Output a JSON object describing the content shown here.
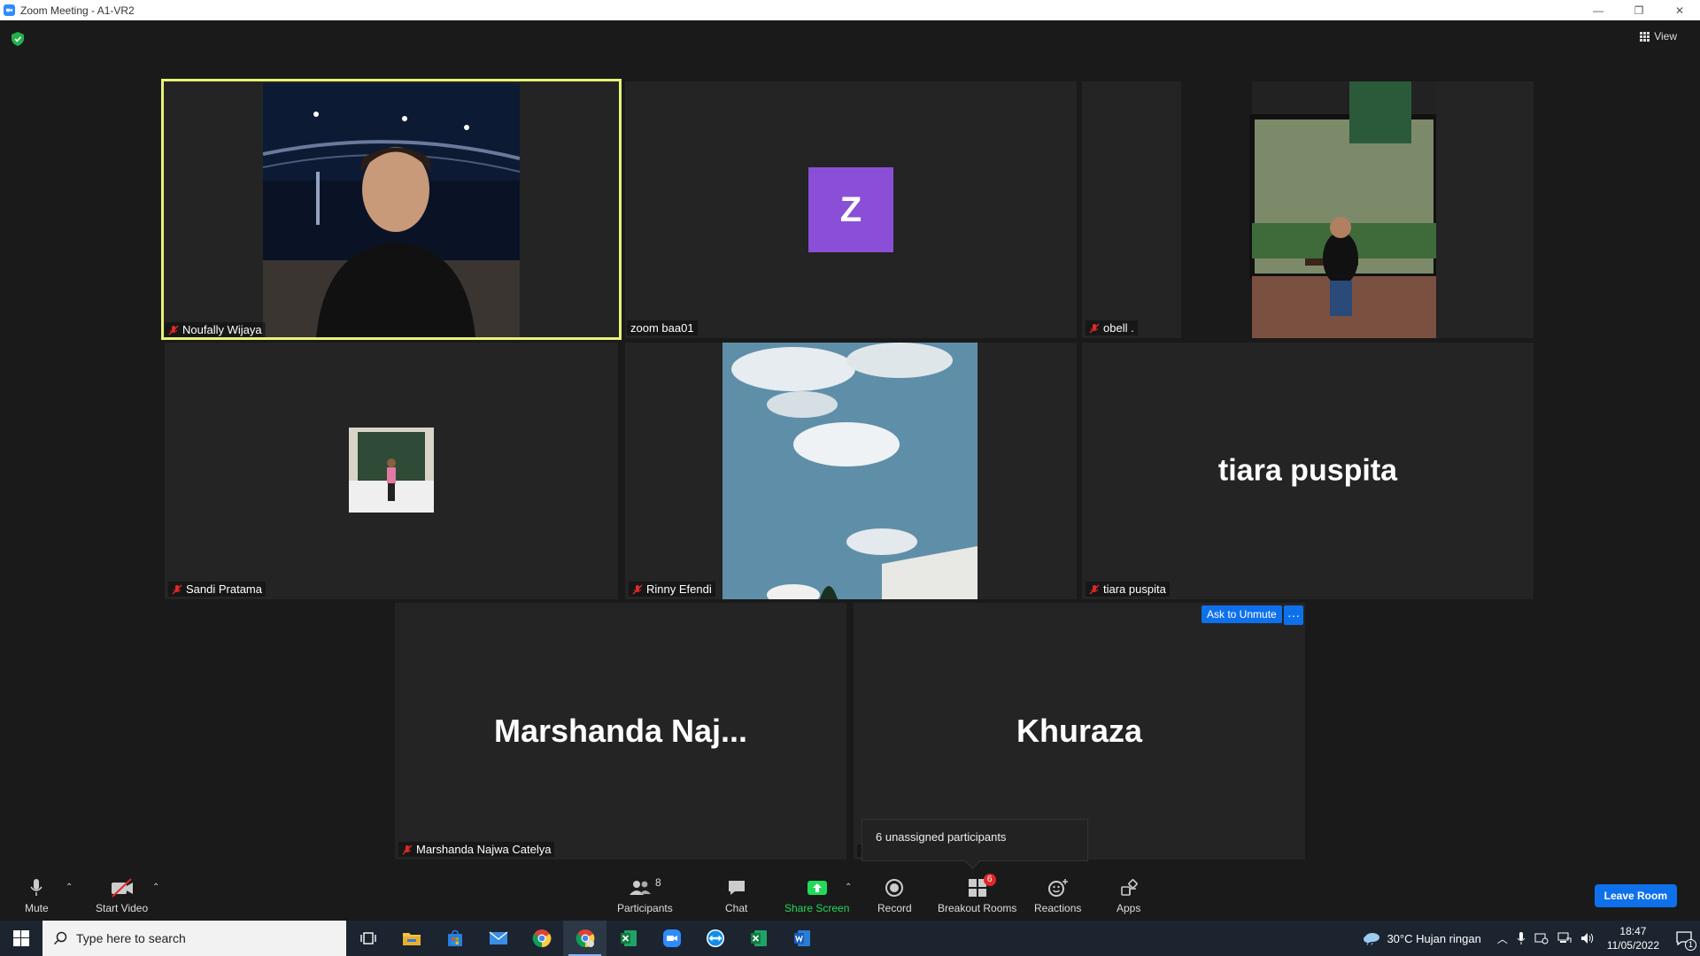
{
  "window": {
    "title": "Zoom Meeting - A1-VR2",
    "minimize": "—",
    "restore": "❐",
    "close": "✕"
  },
  "view_label": "View",
  "participants_tiles": [
    {
      "name": "Noufally Wijaya"
    },
    {
      "name": "zoom baa01",
      "avatar_letter": "Z"
    },
    {
      "name": "obell ."
    },
    {
      "name": "Sandi Pratama"
    },
    {
      "name": "Rinny Efendi"
    },
    {
      "name": "tiara puspita",
      "display_name": "tiara puspita"
    },
    {
      "name": "Marshanda Najwa Catelya",
      "display_name": "Marshanda  Naj..."
    },
    {
      "name": "",
      "display_name": "Khuraza"
    }
  ],
  "ask_unmute_label": "Ask to Unmute",
  "more_label": "···",
  "tooltip_text": "6 unassigned participants",
  "toolbar": {
    "mute": "Mute",
    "start_video": "Start Video",
    "participants": "Participants",
    "participants_count": "8",
    "chat": "Chat",
    "share_screen": "Share Screen",
    "record": "Record",
    "breakout_rooms": "Breakout Rooms",
    "breakout_badge": "6",
    "reactions": "Reactions",
    "apps": "Apps",
    "leave": "Leave Room"
  },
  "taskbar": {
    "search_placeholder": "Type here to search",
    "weather": "30°C  Hujan ringan",
    "time": "18:47",
    "date": "11/05/2022",
    "notif_count": "1"
  },
  "colors": {
    "accent": "#0e71eb",
    "active_speaker": "#e8f27a",
    "share_green": "#23d959",
    "avatar_purple": "#8a4fd6"
  }
}
